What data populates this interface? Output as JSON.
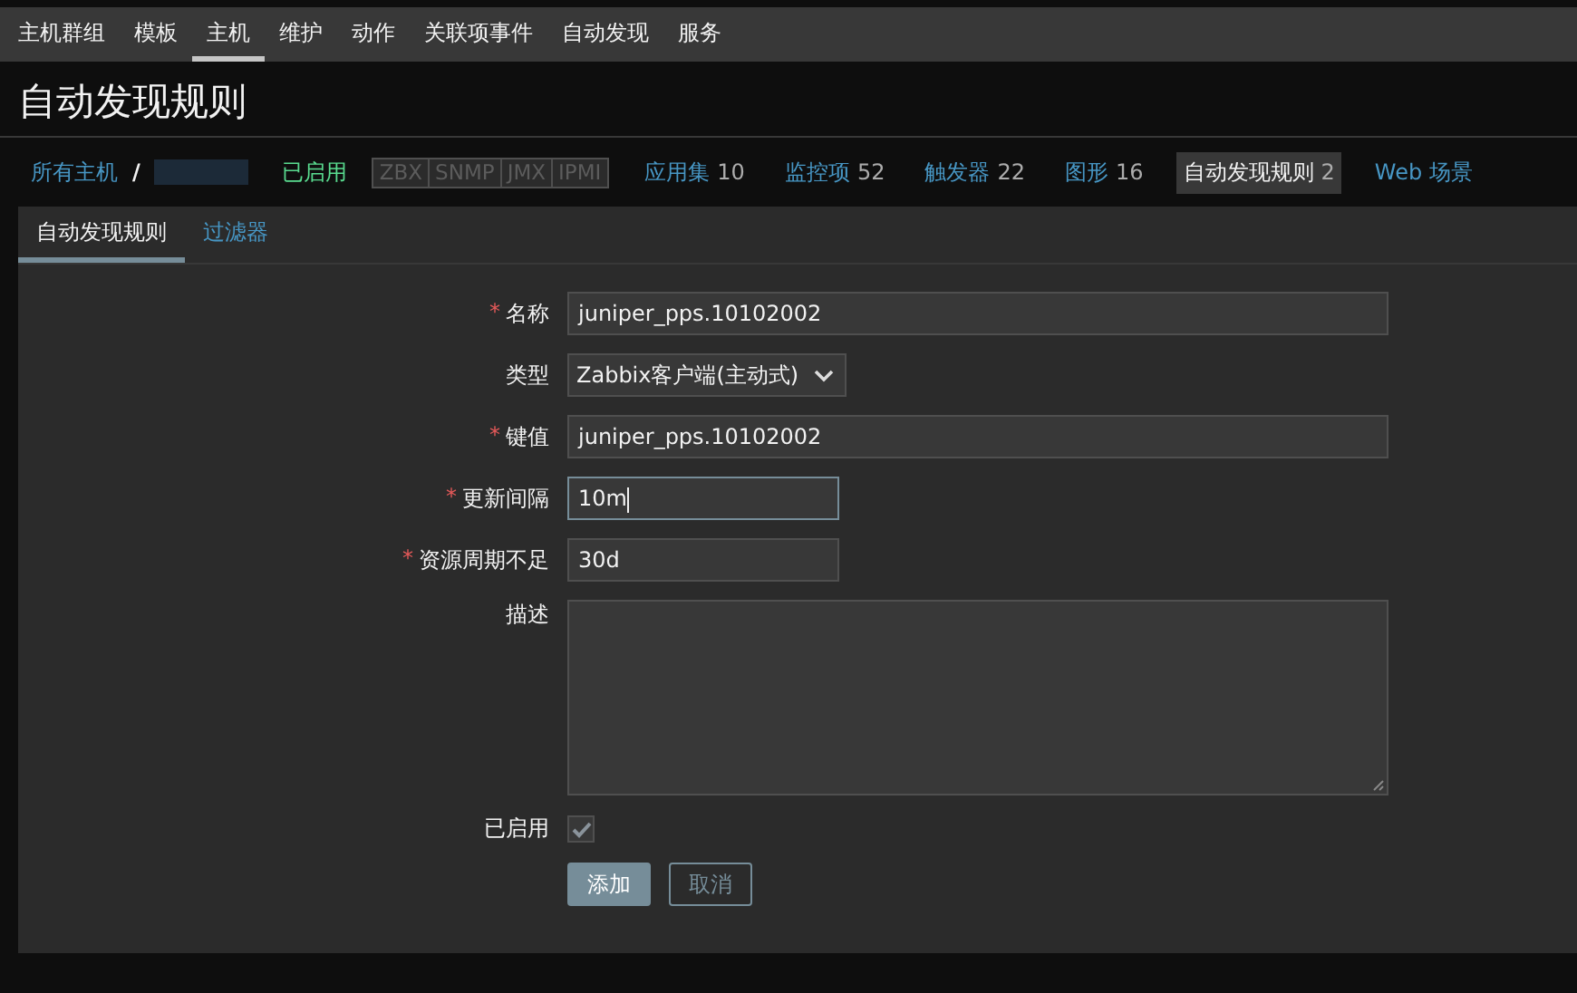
{
  "top_menu": [
    {
      "label": "主机群组",
      "selected": false
    },
    {
      "label": "模板",
      "selected": false
    },
    {
      "label": "主机",
      "selected": true
    },
    {
      "label": "维护",
      "selected": false
    },
    {
      "label": "动作",
      "selected": false
    },
    {
      "label": "关联项事件",
      "selected": false
    },
    {
      "label": "自动发现",
      "selected": false
    },
    {
      "label": "服务",
      "selected": false
    }
  ],
  "page_title": "自动发现规则",
  "breadcrumb": {
    "root": "所有主机",
    "separator": "/",
    "status": "已启用",
    "availability": [
      "ZBX",
      "SNMP",
      "JMX",
      "IPMI"
    ],
    "links": [
      {
        "label": "应用集",
        "count": "10",
        "selected": false
      },
      {
        "label": "监控项",
        "count": "52",
        "selected": false
      },
      {
        "label": "触发器",
        "count": "22",
        "selected": false
      },
      {
        "label": "图形",
        "count": "16",
        "selected": false
      },
      {
        "label": "自动发现规则",
        "count": "2",
        "selected": true
      },
      {
        "label": "Web 场景",
        "selected": false
      }
    ]
  },
  "tabs": [
    {
      "label": "自动发现规则",
      "selected": true
    },
    {
      "label": "过滤器",
      "selected": false
    }
  ],
  "form": [
    {
      "kind": "text",
      "label": "名称",
      "marker": "*",
      "value": "juniper_pps.10102002",
      "wide": true,
      "focused": false
    },
    {
      "kind": "select",
      "label": "类型",
      "value": "Zabbix客户端(主动式)"
    },
    {
      "kind": "text",
      "label": "键值",
      "marker": "*",
      "value": "juniper_pps.10102002",
      "wide": true,
      "focused": false
    },
    {
      "kind": "text",
      "label": "更新间隔",
      "marker": "*",
      "value": "10m",
      "wide": false,
      "focused": true
    },
    {
      "kind": "text",
      "label": "资源周期不足",
      "marker": "*",
      "value": "30d",
      "wide": false,
      "focused": false
    },
    {
      "kind": "textarea",
      "label": "描述"
    },
    {
      "kind": "checkbox",
      "label": "已启用",
      "checked": true
    }
  ],
  "buttons": [
    {
      "label": "添加",
      "primary": true
    },
    {
      "label": "取消",
      "primary": false
    }
  ]
}
